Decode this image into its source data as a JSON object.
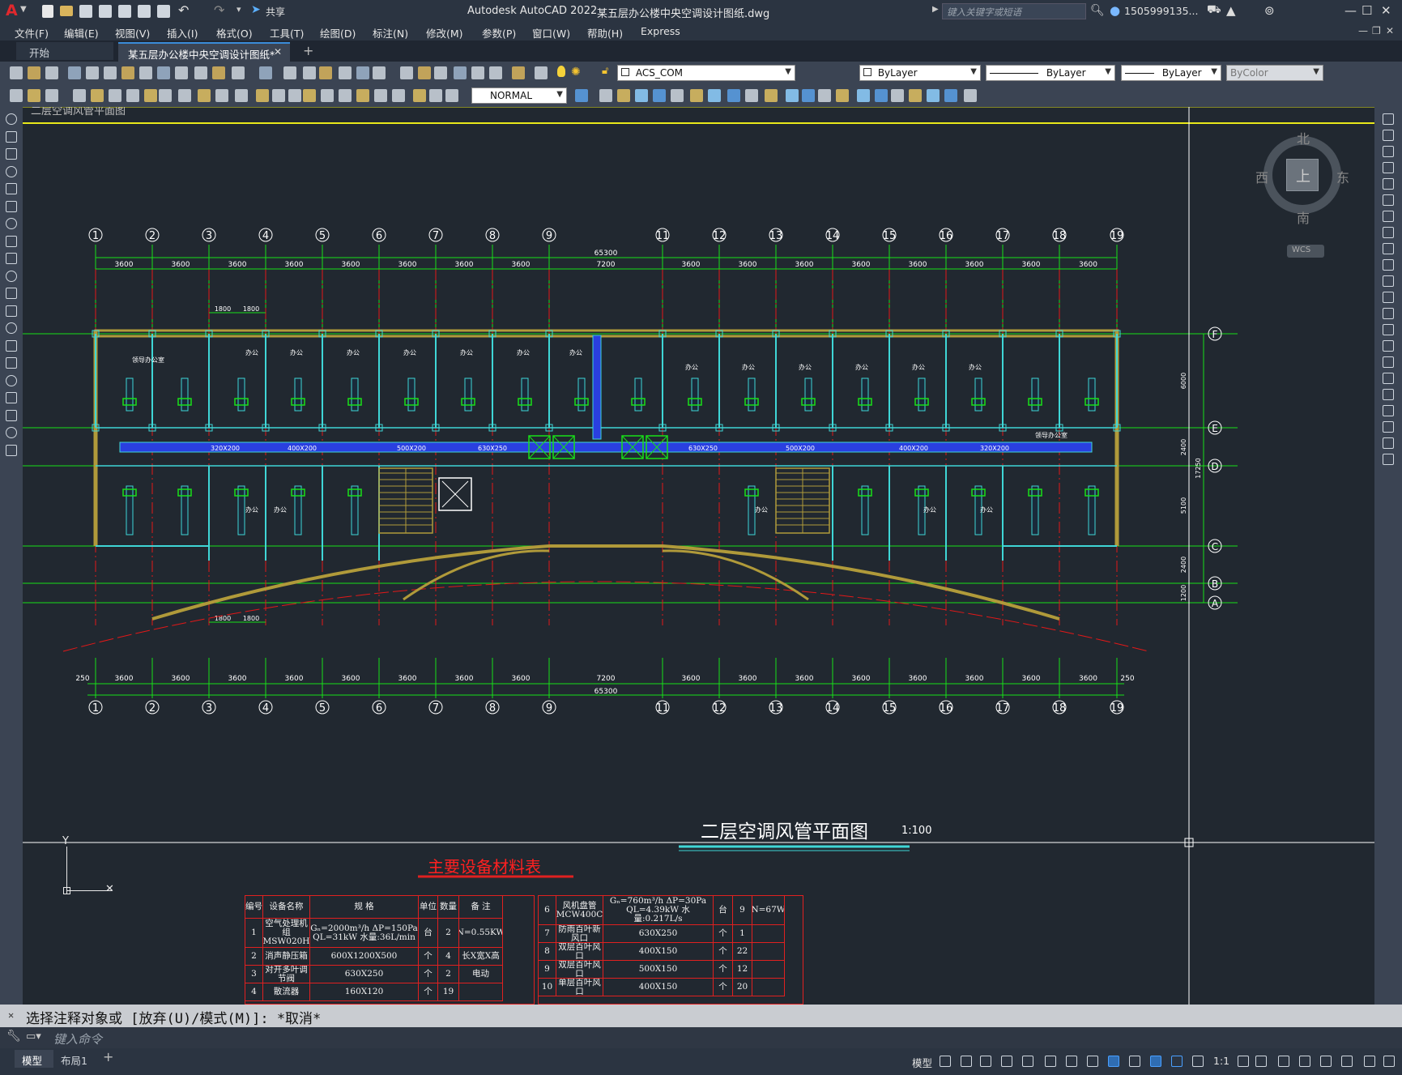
{
  "window": {
    "app_title": "Autodesk AutoCAD 2022",
    "file_title": "某五层办公楼中央空调设计图纸.dwg",
    "search_placeholder": "键入关键字或短语",
    "user": "1505999135...",
    "share_label": "共享",
    "logo": "A"
  },
  "menu": [
    "文件(F)",
    "编辑(E)",
    "视图(V)",
    "插入(I)",
    "格式(O)",
    "工具(T)",
    "绘图(D)",
    "标注(N)",
    "修改(M)",
    "参数(P)",
    "窗口(W)",
    "帮助(H)",
    "Express"
  ],
  "tabs": {
    "start": "开始",
    "active": "某五层办公楼中央空调设计图纸*",
    "close": "✕",
    "add": "+"
  },
  "properties": {
    "layer": "ACS_COM",
    "color": "ByLayer",
    "linetype": "ByLayer",
    "lineweight": "ByLayer",
    "plotstyle": "ByColor",
    "dimstyle": "NORMAL"
  },
  "viewcube": {
    "north": "北",
    "south": "南",
    "east": "东",
    "west": "西",
    "top": "上",
    "wcs": "WCS"
  },
  "drawing": {
    "top_label": "二层空调风管平面图",
    "axis_cols": [
      "1",
      "2",
      "3",
      "4",
      "5",
      "6",
      "7",
      "8",
      "9",
      "11",
      "12",
      "13",
      "14",
      "15",
      "16",
      "17",
      "18",
      "19"
    ],
    "axis_rows": [
      "F",
      "E",
      "D",
      "C",
      "B",
      "A"
    ],
    "total_dim": "65300",
    "span_dims_top": [
      "3600",
      "3600",
      "3600",
      "3600",
      "3600",
      "3600",
      "3600",
      "3600",
      "7200",
      "3600",
      "3600",
      "3600",
      "3600",
      "3600",
      "3600",
      "3600",
      "3600"
    ],
    "span_dims_bottom": [
      "250",
      "3600",
      "3600",
      "3600",
      "3600",
      "3600",
      "3600",
      "3600",
      "3600",
      "7200",
      "3600",
      "3600",
      "3600",
      "3600",
      "3600",
      "3600",
      "3600",
      "3600",
      "250"
    ],
    "dim_1800a": "1800",
    "dim_1800b": "1800",
    "right_dims": [
      "6000",
      "2400",
      "5100",
      "2400",
      "1200"
    ],
    "right_total": "17250",
    "rooms": {
      "leader": "领导办公室",
      "office": "办公"
    },
    "duct_labels": [
      "320X200",
      "400X200",
      "500X200",
      "630X250",
      "630X250",
      "500X200",
      "400X200",
      "320X200"
    ],
    "plan_title": "二层空调风管平面图",
    "plan_scale": "1:100",
    "table_title": "主要设备材料表"
  },
  "table1": {
    "headers": [
      "编号",
      "设备名称",
      "规 格",
      "单位",
      "数量",
      "备 注"
    ],
    "rows": [
      [
        "1",
        "空气处理机组 MSW020H",
        "Gₙ=2000m³/h ΔP=150Pa QL=31kW 水量:36L/min",
        "台",
        "2",
        "N=0.55KW"
      ],
      [
        "2",
        "消声静压箱",
        "600X1200X500",
        "个",
        "4",
        "长X宽X高"
      ],
      [
        "3",
        "对开多叶调节阀",
        "630X250",
        "个",
        "2",
        "电动"
      ],
      [
        "4",
        "散流器",
        "160X120",
        "个",
        "19",
        ""
      ]
    ]
  },
  "table2": {
    "rows": [
      [
        "6",
        "风机盘管 MCW400C",
        "Gₙ=760m³/h ΔP=30Pa QL=4.39kW 水量:0.217L/s",
        "台",
        "9",
        "N=67W"
      ],
      [
        "7",
        "防雨百叶新风口",
        "630X250",
        "个",
        "1",
        ""
      ],
      [
        "8",
        "双层百叶风口",
        "400X150",
        "个",
        "22",
        ""
      ],
      [
        "9",
        "双层百叶风口",
        "500X150",
        "个",
        "12",
        ""
      ],
      [
        "10",
        "单层百叶风口",
        "400X150",
        "个",
        "20",
        ""
      ]
    ]
  },
  "command": {
    "history": "选择注释对象或 [放弃(U)/模式(M)]: *取消*",
    "placeholder": "键入命令"
  },
  "status": {
    "model_tab": "模型",
    "layout_tab": "布局1",
    "model_label": "模型",
    "scale": "1:1"
  },
  "colors": {
    "canvas": "#212830",
    "grid_green": "#18e018",
    "axis_red": "#e21818",
    "wall_cyan": "#3fd6d6",
    "duct_blue": "#2a3fe0",
    "yellow": "#e8e81a",
    "hatch": "#b09a3a"
  }
}
